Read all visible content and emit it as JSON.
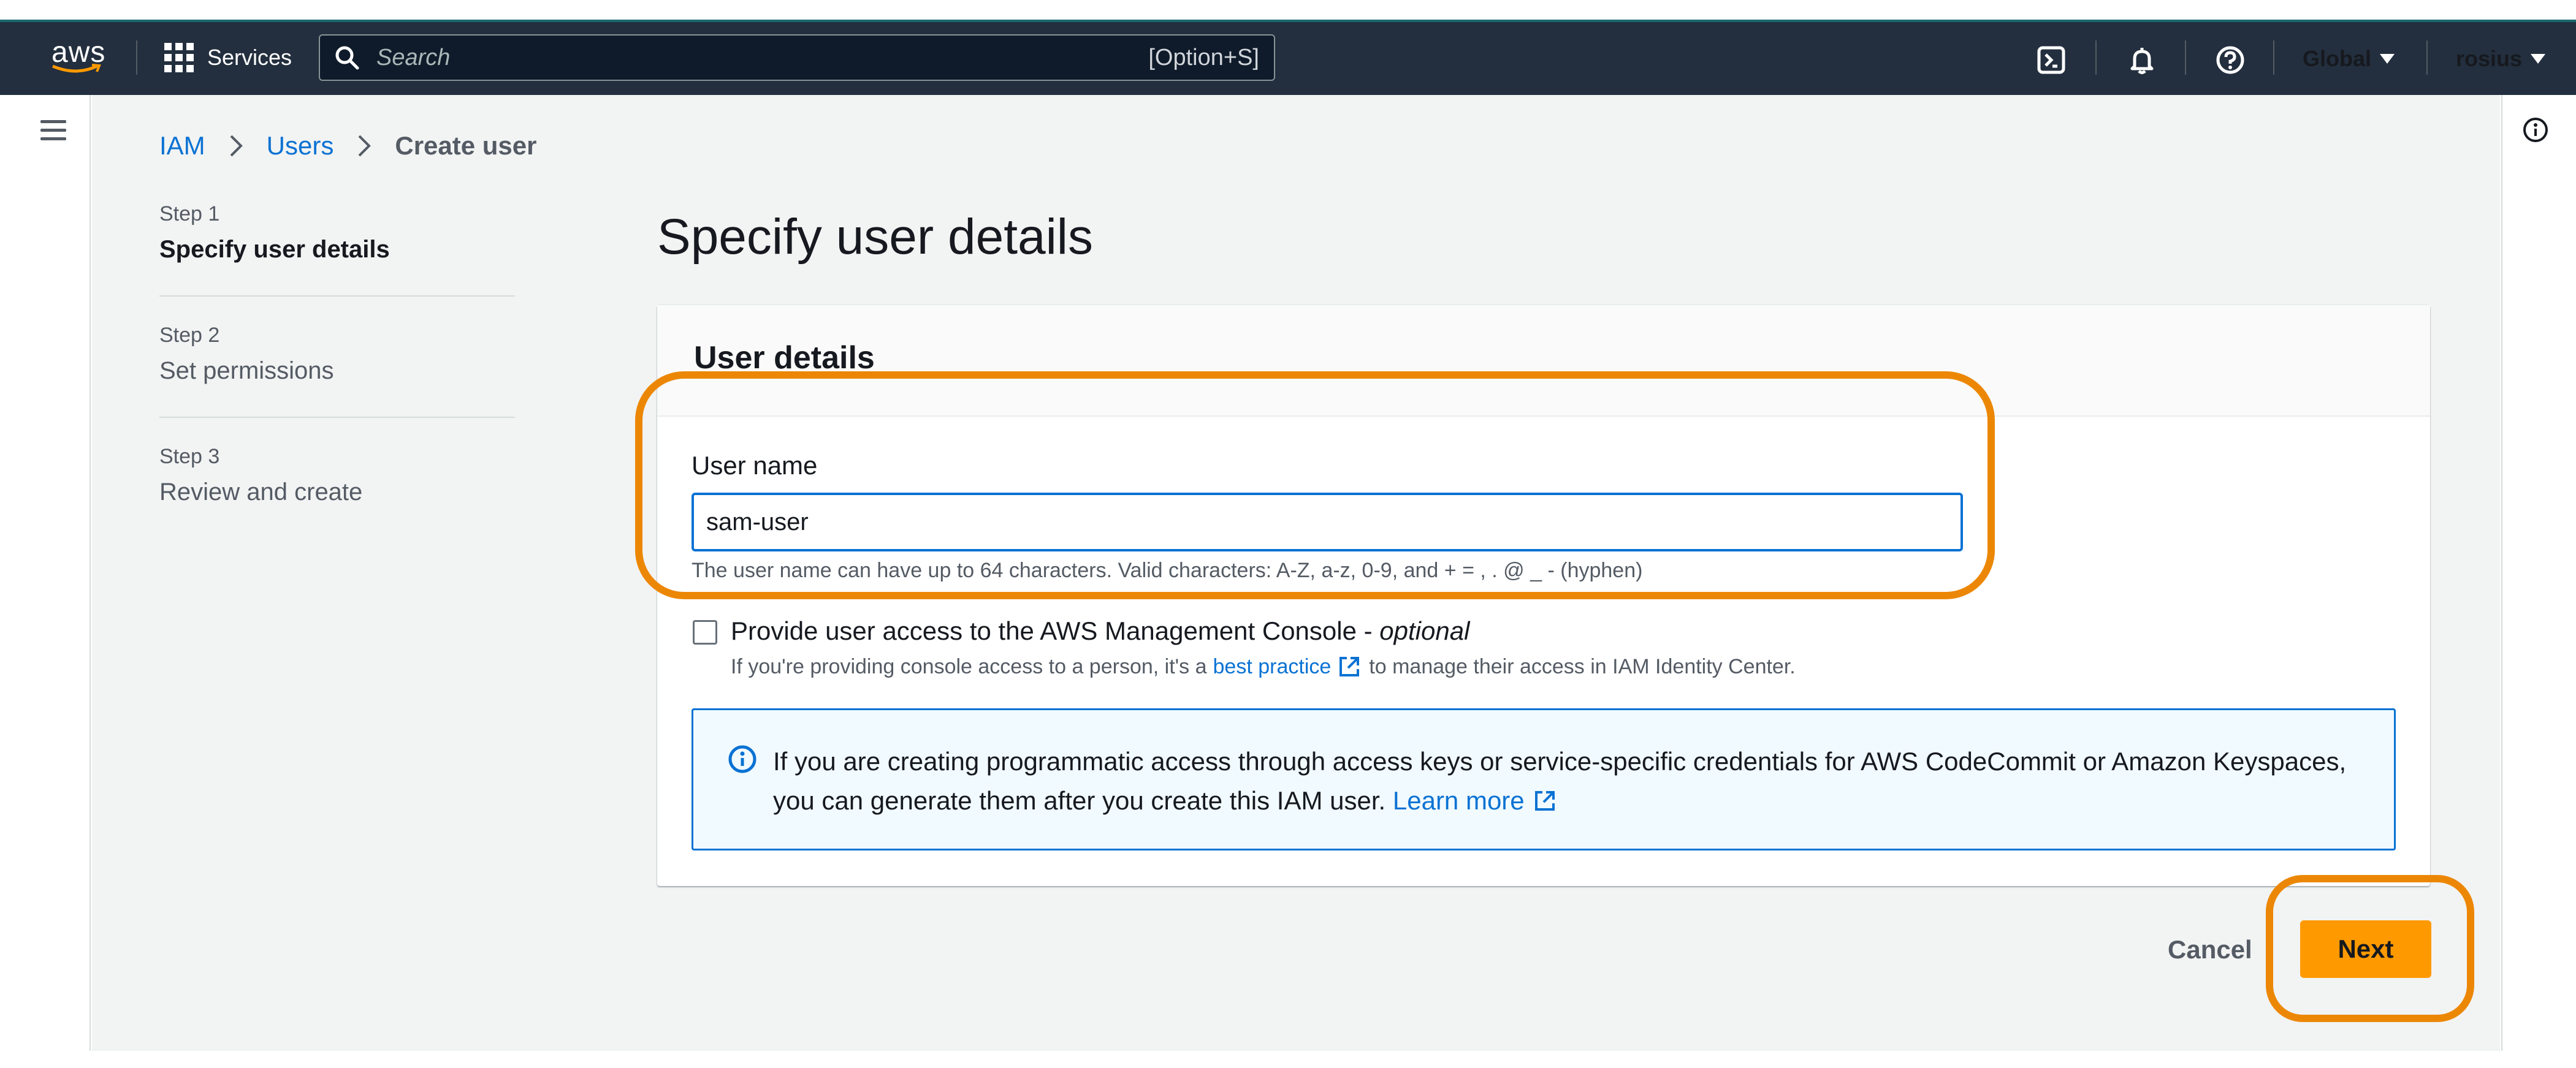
{
  "topbar": {
    "logo_text": "aws",
    "services_label": "Services",
    "search_placeholder": "Search",
    "search_shortcut": "[Option+S]",
    "region_label": "Global",
    "user_label": "rosius"
  },
  "breadcrumb": [
    "IAM",
    "Users",
    "Create user"
  ],
  "steps": [
    {
      "num": "Step 1",
      "title": "Specify user details"
    },
    {
      "num": "Step 2",
      "title": "Set permissions"
    },
    {
      "num": "Step 3",
      "title": "Review and create"
    }
  ],
  "page_title": "Specify user details",
  "panel": {
    "title": "User details",
    "username_label": "User name",
    "username_value": "sam-user",
    "constraint_text": "The user name can have up to 64 characters. Valid characters: A-Z, a-z, 0-9, and + = , . @ _ - (hyphen)",
    "console_access_label": "Provide user access to the AWS Management Console - ",
    "console_access_optional": "optional",
    "console_desc_before": "If you're providing console access to a person, it's a",
    "console_desc_link": "best practice",
    "console_desc_after": "to manage their access in IAM Identity Center.",
    "info_text": "If you are creating programmatic access through access keys or service-specific credentials for AWS CodeCommit or Amazon Keyspaces, you can generate them after you create this IAM user.",
    "info_link": "Learn more"
  },
  "actions": {
    "cancel_label": "Cancel",
    "next_label": "Next"
  },
  "colors": {
    "topbar": "#232f3e",
    "link": "#0972d3",
    "primary_button": "#ff9900",
    "annotation": "#ec8706"
  }
}
